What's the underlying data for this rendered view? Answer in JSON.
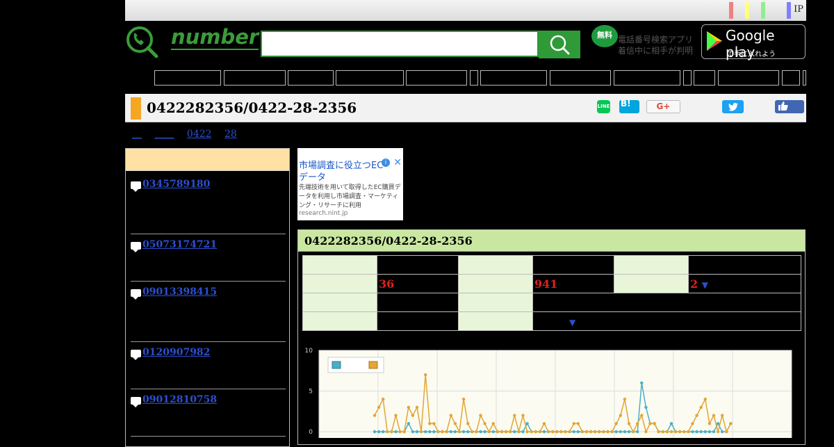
{
  "topbar": {
    "ip_label": "IP",
    "markers": [
      "#f08080",
      "#ffff80",
      "#90ee90",
      "#8080ff"
    ]
  },
  "header": {
    "logo_text": "number",
    "search": {
      "placeholder": "",
      "button_icon": "search-icon"
    },
    "app_badge": "無料",
    "app_text": "電話番号検索アプリ 着信中に相手が判明",
    "google_play": {
      "title": "Google play",
      "subtitle": "で手に入れよう"
    }
  },
  "nav": {
    "button_count": 14
  },
  "page": {
    "title": "0422282356/0422-28-2356",
    "share": {
      "line": "LINE",
      "hatena": "B!",
      "gplus": "G+"
    }
  },
  "breadcrumb": [
    "__",
    "____",
    "0422",
    "28"
  ],
  "sidebar": {
    "items": [
      {
        "number": "0345789180"
      },
      {
        "number": "05073174721"
      },
      {
        "number": "09013398415"
      },
      {
        "number": "0120907982"
      },
      {
        "number": "09012810758"
      }
    ]
  },
  "ad": {
    "headline": "市場調査に役立つECデータ",
    "body": "先端技術を用いて取得したEC購買データを利用し市場調査・マーケティング・リサーチに利用",
    "url": "research.nint.jp"
  },
  "detail": {
    "title": "0422282356/0422-28-2356",
    "values": {
      "v1": "36",
      "v2": "941",
      "v3": "2"
    },
    "arrow": "▼"
  },
  "colors": {
    "accent_green": "#2f9a38",
    "title_orange": "#f5a623",
    "series_blue": "#4aaec7",
    "series_orange": "#e3a534"
  },
  "chart_data": {
    "type": "line",
    "ylim": [
      0,
      10
    ],
    "yticks": [
      0,
      5,
      10
    ],
    "series": [
      {
        "values": [
          0,
          0,
          0,
          0,
          0,
          0,
          0,
          0,
          1,
          0,
          0,
          0,
          0,
          0,
          0,
          0,
          0,
          0,
          0,
          0,
          0,
          0,
          0,
          0,
          0,
          0,
          0,
          0,
          0,
          0,
          0,
          0,
          0,
          0,
          0,
          0,
          1,
          0,
          0,
          0,
          0,
          0,
          0,
          0,
          0,
          0,
          0,
          0,
          0,
          0,
          0,
          0,
          0,
          0,
          0,
          0,
          0,
          0,
          0,
          0,
          0,
          0,
          0,
          6,
          3,
          1,
          1,
          0,
          0,
          0,
          1,
          0,
          0,
          0,
          0,
          0,
          0,
          0,
          0,
          0,
          0,
          1,
          0,
          0,
          1
        ]
      },
      {
        "values": [
          2,
          3,
          4,
          0,
          0,
          2,
          0,
          0,
          3,
          2,
          3,
          0,
          7,
          1,
          1,
          0,
          0,
          0,
          2,
          1,
          0,
          4,
          1,
          0,
          0,
          2,
          1,
          0,
          1,
          0,
          0,
          0,
          0,
          2,
          0,
          2,
          0,
          0,
          0,
          0,
          1,
          0,
          0,
          0,
          0,
          0,
          0,
          1,
          1,
          0,
          0,
          0,
          0,
          0,
          0,
          0,
          0,
          1,
          2,
          4,
          1,
          0,
          1,
          2,
          0,
          1,
          1,
          0,
          0,
          0,
          0,
          0,
          0,
          0,
          0,
          1,
          2,
          3,
          4,
          1,
          2,
          0,
          2,
          0,
          1
        ]
      }
    ]
  }
}
